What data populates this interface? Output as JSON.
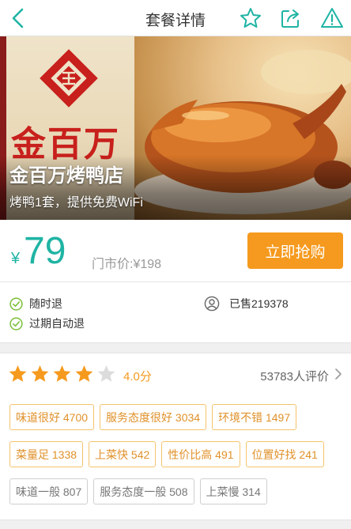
{
  "nav": {
    "title": "套餐详情",
    "icons": [
      "back-icon",
      "star-icon",
      "share-icon",
      "warning-icon"
    ],
    "accent_color": "#1fb4a4"
  },
  "hero": {
    "logo_text": "金百万",
    "shop_name": "金百万烤鸭店",
    "description": "烤鸭1套，提供免费WiFi"
  },
  "price": {
    "currency": "¥",
    "value": "79",
    "market_price": "门市价:¥198",
    "buy_label": "立即抢购",
    "buy_color": "#f59a1e"
  },
  "service": {
    "items": [
      "随时退",
      "过期自动退"
    ],
    "sold": "已售219378",
    "check_color": "#7bbf3a"
  },
  "review": {
    "rating": 4.0,
    "rating_label": "4.0分",
    "count": "53783人评价",
    "tags": [
      [
        {
          "label": "味道很好 4700",
          "tone": "good"
        },
        {
          "label": "服务态度很好 3034",
          "tone": "good"
        },
        {
          "label": "环境不错 1497",
          "tone": "good"
        }
      ],
      [
        {
          "label": "菜量足 1338",
          "tone": "good"
        },
        {
          "label": "上菜快 542",
          "tone": "good"
        },
        {
          "label": "性价比高 491",
          "tone": "good"
        },
        {
          "label": "位置好找 241",
          "tone": "good"
        }
      ],
      [
        {
          "label": "味道一般 807",
          "tone": "neutral"
        },
        {
          "label": "服务态度一般 508",
          "tone": "neutral"
        },
        {
          "label": "上菜慢 314",
          "tone": "neutral"
        }
      ]
    ]
  }
}
